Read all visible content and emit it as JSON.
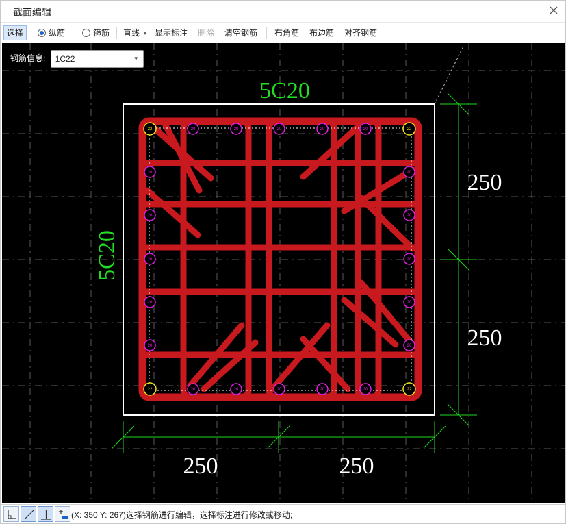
{
  "window": {
    "title": "截面编辑"
  },
  "toolbar": {
    "select": "选择",
    "longitudinal": "纵筋",
    "stirrup": "箍筋",
    "line_mode": "直线",
    "show_dimension": "显示标注",
    "delete": "删除",
    "clear_rebar": "清空钢筋",
    "corner_rebar": "布角筋",
    "edge_rebar": "布边筋",
    "align_rebar": "对齐钢筋",
    "longitudinal_checked": true,
    "stirrup_checked": false
  },
  "rebar_info": {
    "label": "钢筋信息:",
    "value": "1C22"
  },
  "drawing": {
    "top_label": "5C20",
    "left_label": "5C20",
    "dim_right_upper": "250",
    "dim_right_lower": "250",
    "dim_bottom_left": "250",
    "dim_bottom_right": "250",
    "corner_bar_label": "22",
    "side_bar_label": "20",
    "colors": {
      "background": "#000000",
      "grid": "#5a5a5a",
      "section_outline": "#ffffff",
      "stirrup": "#c8191e",
      "side_bar": "#e51fe5",
      "corner_bar": "#f0e020",
      "label_green": "#22dd22",
      "dimension_line": "#1fd81f",
      "dimension_text": "#ffffff"
    }
  },
  "status": {
    "text": "(X: 350 Y: 267)选择钢筋进行编辑，选择标注进行修改或移动;"
  },
  "icons": {
    "close": "close-icon",
    "ortho": "ortho-snap-icon",
    "line": "line-tool-icon",
    "perpendicular": "perpendicular-icon",
    "add_point": "add-point-icon"
  }
}
